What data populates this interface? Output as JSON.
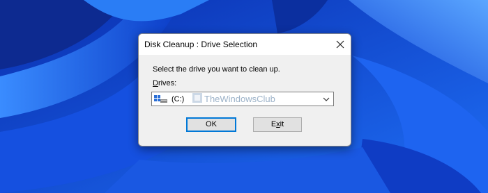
{
  "dialog": {
    "title": "Disk Cleanup : Drive Selection",
    "prompt": "Select the drive you want to clean up.",
    "drives_label_accel": "D",
    "drives_label_rest": "rives:",
    "selected_drive": "(C:)",
    "watermark": "TheWindowsClub",
    "ok_label": "OK",
    "exit_label_accel": "x",
    "exit_label_pre": "E",
    "exit_label_post": "it"
  },
  "icons": [
    "close-icon",
    "drive-icon",
    "chevron-down-icon",
    "windows-club-logo"
  ],
  "colors": {
    "wallpaper": "#1a4fd8",
    "dialog": "#f0f0f0",
    "focus": "#0078d7"
  }
}
